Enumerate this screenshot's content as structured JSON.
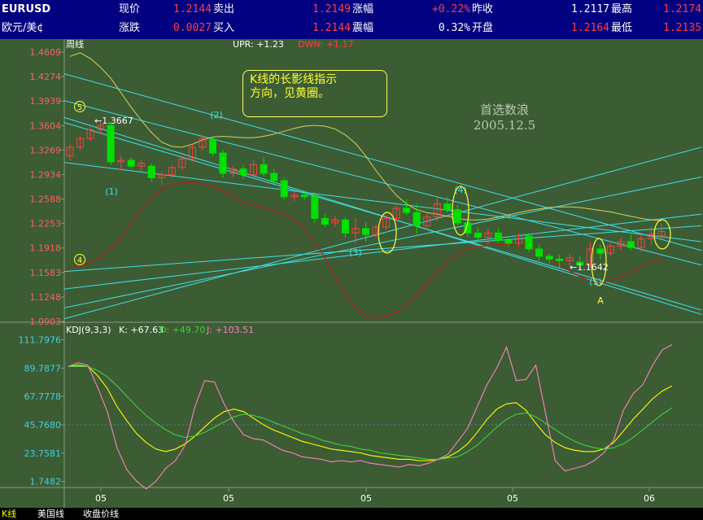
{
  "header": {
    "symbol": "EURUSD",
    "pair_name": "欧元/美¢",
    "row1": [
      {
        "label": "现价",
        "value": "1.2144"
      },
      {
        "label": "卖出",
        "value": "1.2149"
      },
      {
        "label": "涨幅",
        "value": "+0.22%"
      },
      {
        "label": "昨收",
        "value": "1.2117"
      },
      {
        "label": "最高",
        "value": "1.2174"
      }
    ],
    "row2": [
      {
        "label": "涨跌",
        "value": "0.0027"
      },
      {
        "label": "买入",
        "value": "1.2144"
      },
      {
        "label": "震幅",
        "value": "0.32%"
      },
      {
        "label": "开盘",
        "value": "1.2164"
      },
      {
        "label": "最低",
        "value": "1.2135"
      }
    ],
    "colors": {
      "red": "#ff4040",
      "white": "#ffffff",
      "bg": "#000080"
    }
  },
  "annotation": {
    "line1": "K线的长影线指示",
    "line2": "方向，见黄圈。"
  },
  "watermark": {
    "line1": "首选数浪",
    "line2": "2005.12.5"
  },
  "tabs": [
    {
      "label": "K线",
      "active": true
    },
    {
      "label": "美国线",
      "active": false
    },
    {
      "label": "收盘价线",
      "active": false
    }
  ],
  "chart_data": [
    {
      "type": "candlestick",
      "title": "周线",
      "indicator_label": "UPR: +1.23",
      "indicator_label2": "DWN: +1.17",
      "y_ticks": [
        "1.4609",
        "1.4274",
        "1.3939",
        "1.3604",
        "1.3269",
        "1.2934",
        "1.2588",
        "1.2253",
        "1.1918",
        "1.1583",
        "1.1248",
        "1.0903"
      ],
      "ylim": [
        1.0903,
        1.4609
      ],
      "x_ticks": [
        "05",
        "05",
        "05",
        "05",
        "06"
      ],
      "x_tick_index": [
        3,
        14,
        25,
        36,
        47
      ],
      "candles": [
        {
          "o": 1.318,
          "h": 1.334,
          "l": 1.312,
          "c": 1.33
        },
        {
          "o": 1.33,
          "h": 1.345,
          "l": 1.326,
          "c": 1.342
        },
        {
          "o": 1.342,
          "h": 1.358,
          "l": 1.338,
          "c": 1.354
        },
        {
          "o": 1.354,
          "h": 1.3667,
          "l": 1.35,
          "c": 1.36
        },
        {
          "o": 1.36,
          "h": 1.364,
          "l": 1.305,
          "c": 1.31
        },
        {
          "o": 1.31,
          "h": 1.318,
          "l": 1.298,
          "c": 1.312
        },
        {
          "o": 1.312,
          "h": 1.316,
          "l": 1.3,
          "c": 1.304
        },
        {
          "o": 1.304,
          "h": 1.312,
          "l": 1.296,
          "c": 1.308
        },
        {
          "o": 1.304,
          "h": 1.308,
          "l": 1.282,
          "c": 1.288
        },
        {
          "o": 1.288,
          "h": 1.296,
          "l": 1.278,
          "c": 1.292
        },
        {
          "o": 1.292,
          "h": 1.306,
          "l": 1.288,
          "c": 1.302
        },
        {
          "o": 1.302,
          "h": 1.318,
          "l": 1.298,
          "c": 1.314
        },
        {
          "o": 1.314,
          "h": 1.334,
          "l": 1.31,
          "c": 1.33
        },
        {
          "o": 1.33,
          "h": 1.346,
          "l": 1.326,
          "c": 1.342
        },
        {
          "o": 1.34,
          "h": 1.344,
          "l": 1.318,
          "c": 1.322
        },
        {
          "o": 1.322,
          "h": 1.326,
          "l": 1.288,
          "c": 1.294
        },
        {
          "o": 1.294,
          "h": 1.304,
          "l": 1.288,
          "c": 1.3
        },
        {
          "o": 1.3,
          "h": 1.306,
          "l": 1.286,
          "c": 1.292
        },
        {
          "o": 1.292,
          "h": 1.312,
          "l": 1.288,
          "c": 1.306
        },
        {
          "o": 1.306,
          "h": 1.316,
          "l": 1.29,
          "c": 1.294
        },
        {
          "o": 1.294,
          "h": 1.3,
          "l": 1.28,
          "c": 1.284
        },
        {
          "o": 1.284,
          "h": 1.288,
          "l": 1.258,
          "c": 1.262
        },
        {
          "o": 1.262,
          "h": 1.268,
          "l": 1.256,
          "c": 1.264
        },
        {
          "o": 1.264,
          "h": 1.27,
          "l": 1.258,
          "c": 1.262
        },
        {
          "o": 1.262,
          "h": 1.266,
          "l": 1.226,
          "c": 1.232
        },
        {
          "o": 1.232,
          "h": 1.238,
          "l": 1.22,
          "c": 1.224
        },
        {
          "o": 1.226,
          "h": 1.236,
          "l": 1.22,
          "c": 1.23
        },
        {
          "o": 1.23,
          "h": 1.234,
          "l": 1.206,
          "c": 1.212
        },
        {
          "o": 1.212,
          "h": 1.232,
          "l": 1.198,
          "c": 1.218
        },
        {
          "o": 1.218,
          "h": 1.226,
          "l": 1.2,
          "c": 1.21
        },
        {
          "o": 1.21,
          "h": 1.224,
          "l": 1.206,
          "c": 1.22
        },
        {
          "o": 1.22,
          "h": 1.236,
          "l": 1.216,
          "c": 1.232
        },
        {
          "o": 1.232,
          "h": 1.25,
          "l": 1.228,
          "c": 1.246
        },
        {
          "o": 1.246,
          "h": 1.258,
          "l": 1.236,
          "c": 1.24
        },
        {
          "o": 1.24,
          "h": 1.252,
          "l": 1.21,
          "c": 1.222
        },
        {
          "o": 1.222,
          "h": 1.238,
          "l": 1.216,
          "c": 1.234
        },
        {
          "o": 1.234,
          "h": 1.262,
          "l": 1.228,
          "c": 1.252
        },
        {
          "o": 1.252,
          "h": 1.262,
          "l": 1.24,
          "c": 1.244
        },
        {
          "o": 1.244,
          "h": 1.25,
          "l": 1.222,
          "c": 1.226
        },
        {
          "o": 1.226,
          "h": 1.232,
          "l": 1.206,
          "c": 1.212
        },
        {
          "o": 1.212,
          "h": 1.22,
          "l": 1.2,
          "c": 1.206
        },
        {
          "o": 1.206,
          "h": 1.218,
          "l": 1.196,
          "c": 1.212
        },
        {
          "o": 1.212,
          "h": 1.218,
          "l": 1.198,
          "c": 1.202
        },
        {
          "o": 1.202,
          "h": 1.208,
          "l": 1.194,
          "c": 1.198
        },
        {
          "o": 1.198,
          "h": 1.212,
          "l": 1.194,
          "c": 1.208
        },
        {
          "o": 1.208,
          "h": 1.212,
          "l": 1.186,
          "c": 1.19
        },
        {
          "o": 1.19,
          "h": 1.196,
          "l": 1.174,
          "c": 1.18
        },
        {
          "o": 1.18,
          "h": 1.184,
          "l": 1.17,
          "c": 1.176
        },
        {
          "o": 1.176,
          "h": 1.182,
          "l": 1.1642,
          "c": 1.174
        },
        {
          "o": 1.174,
          "h": 1.184,
          "l": 1.166,
          "c": 1.178
        },
        {
          "o": 1.172,
          "h": 1.18,
          "l": 1.1642,
          "c": 1.168
        },
        {
          "o": 1.168,
          "h": 1.2,
          "l": 1.164,
          "c": 1.19
        },
        {
          "o": 1.19,
          "h": 1.196,
          "l": 1.176,
          "c": 1.184
        },
        {
          "o": 1.184,
          "h": 1.198,
          "l": 1.18,
          "c": 1.194
        },
        {
          "o": 1.194,
          "h": 1.206,
          "l": 1.188,
          "c": 1.2
        },
        {
          "o": 1.2,
          "h": 1.21,
          "l": 1.188,
          "c": 1.192
        },
        {
          "o": 1.192,
          "h": 1.21,
          "l": 1.186,
          "c": 1.204
        },
        {
          "o": 1.204,
          "h": 1.22,
          "l": 1.196,
          "c": 1.21
        },
        {
          "o": 1.208,
          "h": 1.225,
          "l": 1.204,
          "c": 1.214
        }
      ],
      "upper_band": [
        1.455,
        1.46,
        1.452,
        1.44,
        1.425,
        1.405,
        1.385,
        1.367,
        1.35,
        1.337,
        1.331,
        1.33,
        1.334,
        1.34,
        1.344,
        1.345,
        1.344,
        1.343,
        1.343,
        1.345,
        1.348,
        1.352,
        1.356,
        1.359,
        1.36,
        1.359,
        1.355,
        1.347,
        1.335,
        1.318,
        1.298,
        1.28,
        1.264,
        1.252,
        1.244,
        1.24,
        1.238,
        1.235,
        1.232,
        1.23,
        1.23,
        1.231,
        1.234,
        1.237,
        1.24,
        1.243,
        1.245,
        1.247,
        1.248,
        1.248,
        1.247,
        1.245,
        1.243,
        1.241,
        1.238,
        1.235,
        1.232,
        1.23,
        1.229
      ],
      "lower_band": [
        1.164,
        1.166,
        1.172,
        1.18,
        1.19,
        1.205,
        1.225,
        1.245,
        1.26,
        1.272,
        1.278,
        1.281,
        1.282,
        1.28,
        1.276,
        1.27,
        1.262,
        1.254,
        1.25,
        1.247,
        1.243,
        1.238,
        1.23,
        1.218,
        1.2,
        1.178,
        1.153,
        1.128,
        1.109,
        1.098,
        1.095,
        1.097,
        1.103,
        1.113,
        1.127,
        1.142,
        1.158,
        1.172,
        1.183,
        1.19,
        1.193,
        1.195,
        1.196,
        1.196,
        1.195,
        1.192,
        1.186,
        1.178,
        1.168,
        1.16,
        1.152,
        1.146,
        1.144,
        1.146,
        1.151,
        1.158,
        1.165,
        1.172,
        1.176
      ],
      "trendlines": [
        {
          "y1": 1.431,
          "y2": 1.188
        },
        {
          "y1": 1.394,
          "y2": 1.168
        },
        {
          "y1": 1.309,
          "y2": 1.2
        },
        {
          "y1": 1.364,
          "y2": 1.106
        },
        {
          "y1": 1.371,
          "y2": 1.1
        },
        {
          "y1": 1.159,
          "y2": 1.222
        },
        {
          "y1": 1.094,
          "y2": 1.33
        },
        {
          "y1": 1.109,
          "y2": 1.289
        },
        {
          "y1": 1.135,
          "y2": 1.238
        }
      ],
      "wave_labels": [
        "(5)",
        "(2)",
        "(1)",
        "(4)",
        "(3)",
        "(4)",
        "(5)",
        "A",
        "4",
        "5"
      ],
      "price_labels": [
        "1.3667",
        "1.1642"
      ]
    },
    {
      "type": "line",
      "title": "KDJ(9,3,3)",
      "legend": [
        {
          "label": "K: +67.63",
          "color": "#ffffff"
        },
        {
          "label": "D: +49.70",
          "color": "#40d040"
        },
        {
          "label": "J: +103.51",
          "color": "#ff80c0"
        }
      ],
      "y_ticks": [
        "111.7976",
        "89.7877",
        "67.7778",
        "45.7680",
        "23.7581",
        "1.7482"
      ],
      "ylim": [
        -6,
        114
      ],
      "series": [
        {
          "name": "K",
          "color": "#ffff00",
          "values": [
            91,
            92,
            91,
            84,
            74,
            60,
            49,
            39,
            32,
            27,
            25,
            27,
            31,
            37,
            44,
            51,
            56,
            58,
            56,
            51,
            46,
            42,
            39,
            36,
            33,
            31,
            29,
            27,
            26,
            25,
            24,
            22,
            21,
            20,
            19,
            19,
            18,
            18,
            19,
            21,
            25,
            31,
            40,
            50,
            58,
            62,
            63,
            57,
            47,
            38,
            32,
            28,
            26,
            25,
            25,
            27,
            32,
            41,
            50,
            58,
            66,
            72,
            76
          ]
        },
        {
          "name": "D",
          "color": "#40d040",
          "values": [
            91,
            91,
            91,
            88,
            83,
            76,
            68,
            60,
            53,
            47,
            42,
            38,
            36,
            37,
            40,
            44,
            48,
            52,
            54,
            53,
            51,
            48,
            45,
            42,
            39,
            37,
            34,
            32,
            30,
            29,
            27,
            26,
            24,
            23,
            22,
            21,
            20,
            19,
            19,
            20,
            21,
            25,
            30,
            37,
            44,
            50,
            54,
            55,
            52,
            47,
            42,
            37,
            33,
            30,
            28,
            27,
            28,
            31,
            36,
            42,
            48,
            54,
            59
          ]
        },
        {
          "name": "J",
          "color": "#ff80c0",
          "values": [
            91,
            94,
            92,
            75,
            56,
            28,
            11,
            2,
            -4,
            2,
            12,
            18,
            30,
            60,
            80,
            79,
            62,
            48,
            38,
            35,
            34,
            30,
            26,
            24,
            21,
            20,
            19,
            17,
            18,
            17,
            18,
            16,
            15,
            14,
            13,
            15,
            14,
            16,
            19,
            23,
            33,
            43,
            60,
            77,
            90,
            106,
            80,
            81,
            92,
            55,
            18,
            10,
            12,
            14,
            18,
            24,
            34,
            57,
            70,
            77,
            92,
            104,
            108
          ]
        }
      ],
      "x_ticks": [
        "05",
        "05",
        "05",
        "05",
        "06"
      ]
    }
  ]
}
